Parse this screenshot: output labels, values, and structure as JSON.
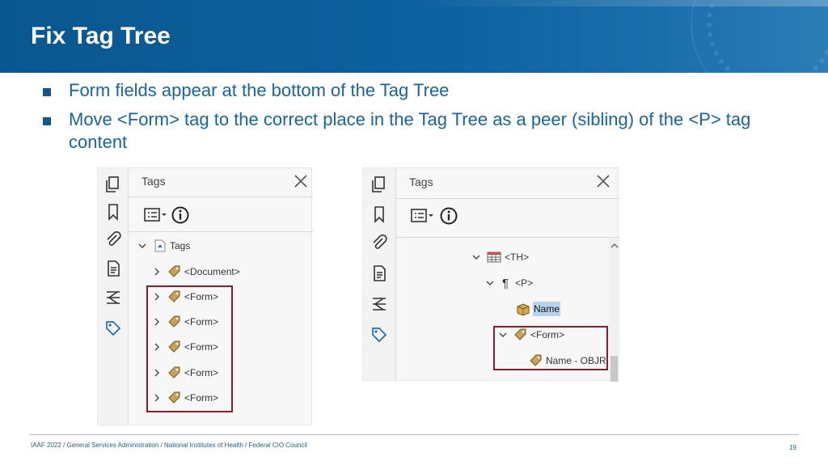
{
  "header": {
    "title": "Fix Tag Tree"
  },
  "bullets": [
    "Form fields appear at the bottom of the Tag Tree",
    "Move <Form> tag to the correct place in the Tag Tree as a peer (sibling) of the <P> tag content"
  ],
  "left_panel": {
    "title": "Tags",
    "root_label": "Tags",
    "document_label": "<Document>",
    "form_labels": [
      "<Form>",
      "<Form>",
      "<Form>",
      "<Form>",
      "<Form>"
    ]
  },
  "right_panel": {
    "title": "Tags",
    "th_label": "<TH>",
    "p_label": "<P>",
    "name_label": "Name",
    "form_label": "<Form>",
    "objr_label": "Name - OBJR"
  },
  "footer": {
    "text": "IAAF 2022  /  General Services Administration  /  National Institutes of Health  /  Federal CIO Council",
    "page_number": "19"
  },
  "colors": {
    "header_blue": "#0d62a0",
    "bullet_text": "#1565a8",
    "highlight_box": "#8b1c2a",
    "selection": "#b8d3ee"
  }
}
